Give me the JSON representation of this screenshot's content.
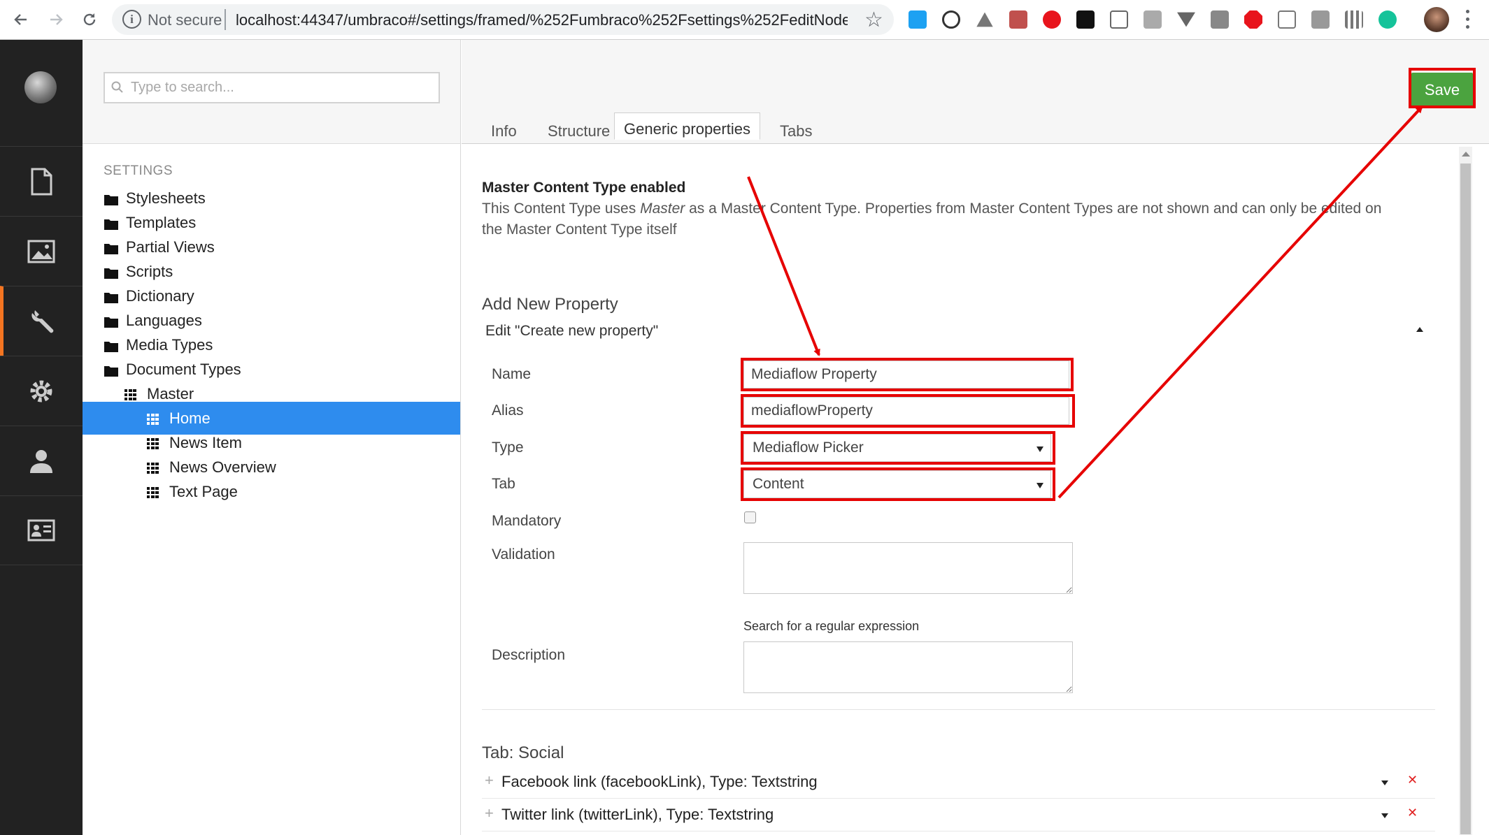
{
  "browser": {
    "not_secure": "Not secure",
    "url": "localhost:44347/umbraco#/settings/framed/%252Fumbraco%252Fsettings%252FeditNodeTy..."
  },
  "sidebar": {
    "search_placeholder": "Type to search...",
    "section_label": "SETTINGS",
    "items": [
      {
        "label": "Stylesheets",
        "icon": "folder-icon"
      },
      {
        "label": "Templates",
        "icon": "folder-icon"
      },
      {
        "label": "Partial Views",
        "icon": "folder-icon"
      },
      {
        "label": "Scripts",
        "icon": "folder-icon"
      },
      {
        "label": "Dictionary",
        "icon": "folder-icon"
      },
      {
        "label": "Languages",
        "icon": "folder-icon"
      },
      {
        "label": "Media Types",
        "icon": "folder-icon"
      },
      {
        "label": "Document Types",
        "icon": "folder-icon"
      },
      {
        "label": "Master",
        "icon": "doctype-icon"
      },
      {
        "label": "Home",
        "icon": "doctype-icon",
        "selected": true
      },
      {
        "label": "News Item",
        "icon": "doctype-icon"
      },
      {
        "label": "News Overview",
        "icon": "doctype-icon"
      },
      {
        "label": "Text Page",
        "icon": "doctype-icon"
      }
    ]
  },
  "toolbar": {
    "save_label": "Save"
  },
  "tabs": [
    {
      "label": "Info"
    },
    {
      "label": "Structure"
    },
    {
      "label": "Generic properties",
      "active": true
    },
    {
      "label": "Tabs"
    }
  ],
  "master": {
    "title": "Master Content Type enabled",
    "line1_prefix": "This Content Type uses ",
    "line1_em": "Master",
    "line1_suffix": " as a Master Content Type. Properties from Master Content Types are not shown and can only be edited on",
    "line2": "the Master Content Type itself"
  },
  "add_property": {
    "heading": "Add New Property",
    "edit_title": "Edit \"Create new property\"",
    "name_label": "Name",
    "name_value": "Mediaflow Property",
    "alias_label": "Alias",
    "alias_value": "mediaflowProperty",
    "type_label": "Type",
    "type_value": "Mediaflow Picker",
    "tab_label": "Tab",
    "tab_value": "Content",
    "mandatory_label": "Mandatory",
    "validation_label": "Validation",
    "regex_link": "Search for a regular expression",
    "description_label": "Description"
  },
  "social": {
    "heading": "Tab: Social",
    "rows": [
      {
        "label": "Facebook link (facebookLink), Type: Textstring"
      },
      {
        "label": "Twitter link (twitterLink), Type: Textstring"
      }
    ]
  },
  "colors": {
    "save_green": "#4ba33f",
    "selected_blue": "#2e8cee",
    "active_section": "#f47521",
    "annotation_red": "#e60000"
  }
}
